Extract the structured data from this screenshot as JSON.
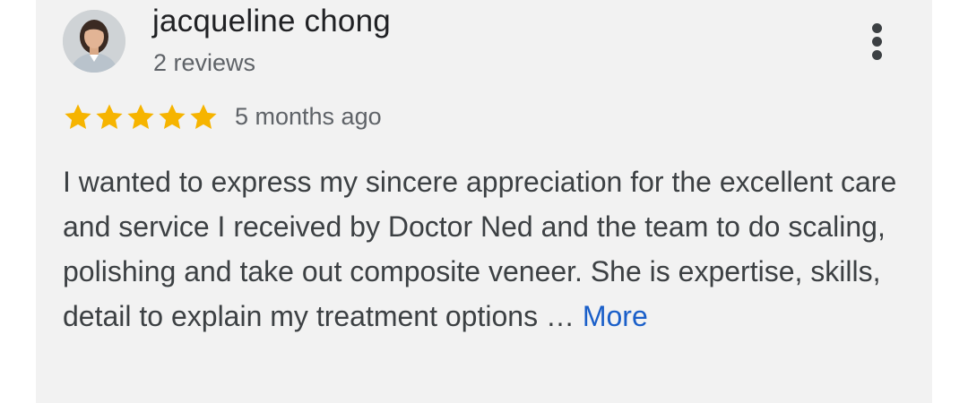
{
  "review": {
    "author_name": "jacqueline chong",
    "review_count": "2 reviews",
    "rating": 5,
    "rating_max": 5,
    "star_color": "#f6b400",
    "time_ago": "5 months ago",
    "text": "I wanted to express my sincere appreciation for the excellent care and service I received by Doctor Ned and the team to do scaling, polishing and take out composite veneer. She is expertise, skills, detail to explain my treatment options …",
    "more_label": "More",
    "menu_icon": "more-vert-icon",
    "link_color": "#1a5fc9"
  }
}
